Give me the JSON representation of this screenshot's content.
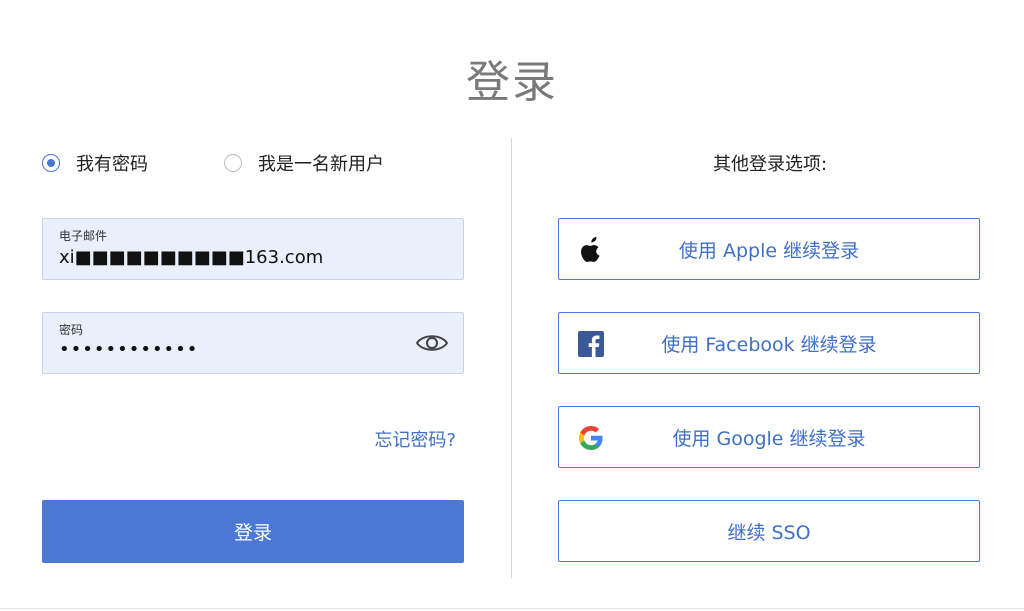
{
  "title": "登录",
  "auth_mode": {
    "options": [
      {
        "label": "我有密码",
        "selected": true
      },
      {
        "label": "我是一名新用户",
        "selected": false
      }
    ]
  },
  "email": {
    "label": "电子邮件",
    "value": "xi■■■■■■■■■■163.com"
  },
  "password": {
    "label": "密码",
    "value": "••••••••••••",
    "toggle_icon": "eye-icon"
  },
  "forgot_password": "忘记密码?",
  "login_button": "登录",
  "other_options": {
    "title": "其他登录选项:",
    "buttons": [
      {
        "label": "使用 Apple 继续登录",
        "icon": "apple-icon"
      },
      {
        "label": "使用 Facebook 继续登录",
        "icon": "facebook-icon"
      },
      {
        "label": "使用 Google 继续登录",
        "icon": "google-icon"
      },
      {
        "label": "继续 SSO",
        "icon": ""
      }
    ]
  },
  "colors": {
    "accent": "#4a78d4",
    "link": "#3f6fc9",
    "field_bg": "#e9effb",
    "title_gray": "#7a7a7a"
  }
}
